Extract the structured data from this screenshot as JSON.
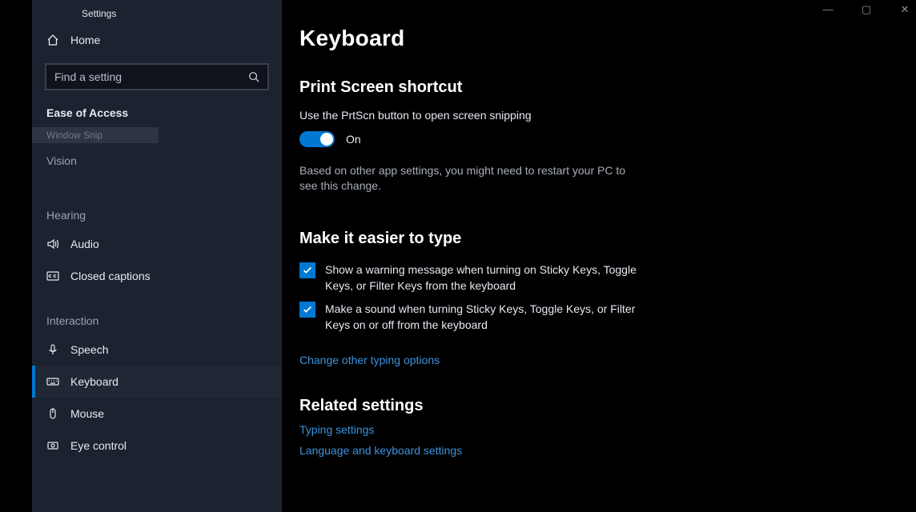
{
  "window_title": "Settings",
  "sidebar": {
    "home_label": "Home",
    "search_placeholder": "Find a setting",
    "category_header": "Ease of Access",
    "window_snip": "Window Snip",
    "groups": [
      {
        "header": "Vision",
        "items": []
      },
      {
        "header": "Hearing",
        "items": [
          {
            "id": "audio",
            "label": "Audio",
            "icon": "speaker"
          },
          {
            "id": "closed-captions",
            "label": "Closed captions",
            "icon": "cc"
          }
        ]
      },
      {
        "header": "Interaction",
        "items": [
          {
            "id": "speech",
            "label": "Speech",
            "icon": "mic"
          },
          {
            "id": "keyboard",
            "label": "Keyboard",
            "icon": "keyboard",
            "active": true
          },
          {
            "id": "mouse",
            "label": "Mouse",
            "icon": "mouse"
          },
          {
            "id": "eye-control",
            "label": "Eye control",
            "icon": "eye"
          }
        ]
      }
    ]
  },
  "main": {
    "title": "Keyboard",
    "section_print": {
      "heading": "Print Screen shortcut",
      "desc": "Use the PrtScn button to open screen snipping",
      "toggle_state": "On",
      "note": "Based on other app settings, you might need to restart your PC to see this change."
    },
    "section_type": {
      "heading": "Make it easier to type",
      "check1": "Show a warning message when turning on Sticky Keys, Toggle Keys, or Filter Keys from the keyboard",
      "check2": "Make a sound when turning Sticky Keys, Toggle Keys, or Filter Keys on or off from the keyboard",
      "link": "Change other typing options"
    },
    "section_related": {
      "heading": "Related settings",
      "link1": "Typing settings",
      "link2": "Language and keyboard settings"
    }
  },
  "titlebar": {
    "min": "—",
    "max": "▢",
    "close": "✕"
  }
}
